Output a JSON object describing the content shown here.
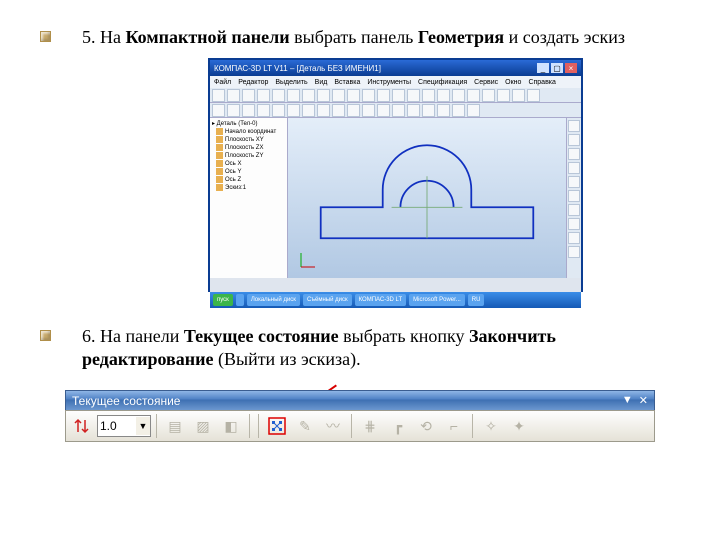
{
  "step5": {
    "prefix": "5. На ",
    "bold1": "Компактной панели",
    "mid": " выбрать панель ",
    "bold2": "Геометрия",
    "suffix": " и создать эскиз"
  },
  "step6": {
    "prefix": "6. На панели ",
    "bold1": "Текущее состояние",
    "mid": " выбрать кнопку  ",
    "bold2": "Закончить редактирование",
    "suffix": " (Выйти из эскиза)."
  },
  "cad": {
    "title": "КОМПАС-3D LT V11 – [Деталь БЕЗ ИМЕНИ1]",
    "menu": [
      "Файл",
      "Редактор",
      "Выделить",
      "Вид",
      "Вставка",
      "Инструменты",
      "Спецификация",
      "Сервис",
      "Окно",
      "Справка"
    ],
    "tree": {
      "root": "Деталь (Тел-0)",
      "items": [
        "Начало координат",
        "Плоскость XY",
        "Плоскость ZX",
        "Плоскость ZY",
        "Ось X",
        "Ось Y",
        "Ось Z",
        "Эскиз:1"
      ]
    },
    "taskbar": [
      "пуск",
      "",
      "Локальный диск",
      "Съёмный диск",
      "КОМПАС-3D LT",
      "Microsoft Power...",
      "RU"
    ]
  },
  "toolbar2": {
    "title": "Текущее состояние",
    "dropdown_symbol": "▼",
    "close_symbol": "✕",
    "scale_value": "1.0",
    "buttons": [
      {
        "name": "toggle-grid-icon",
        "glyph": "⇵",
        "enabled": true
      },
      {
        "name": "layers-icon",
        "glyph": "▤",
        "enabled": false
      },
      {
        "name": "hatch-icon",
        "glyph": "▨",
        "enabled": false
      },
      {
        "name": "state-icon",
        "glyph": "◧",
        "enabled": false
      },
      {
        "name": "exit-sketch-icon",
        "glyph": "EXIT",
        "enabled": true,
        "highlight": true
      },
      {
        "name": "paint-icon",
        "glyph": "✎",
        "enabled": false
      },
      {
        "name": "brush-icon",
        "glyph": "〰",
        "enabled": false
      },
      {
        "name": "grid-icon",
        "glyph": "⋕",
        "enabled": false
      },
      {
        "name": "ortho-icon",
        "glyph": "┏",
        "enabled": false
      },
      {
        "name": "round-icon",
        "glyph": "⟲",
        "enabled": false
      },
      {
        "name": "step-icon",
        "glyph": "⌐",
        "enabled": false
      },
      {
        "name": "snap-icon",
        "glyph": "✧",
        "enabled": false
      },
      {
        "name": "snap2-icon",
        "glyph": "✦",
        "enabled": false
      }
    ]
  }
}
